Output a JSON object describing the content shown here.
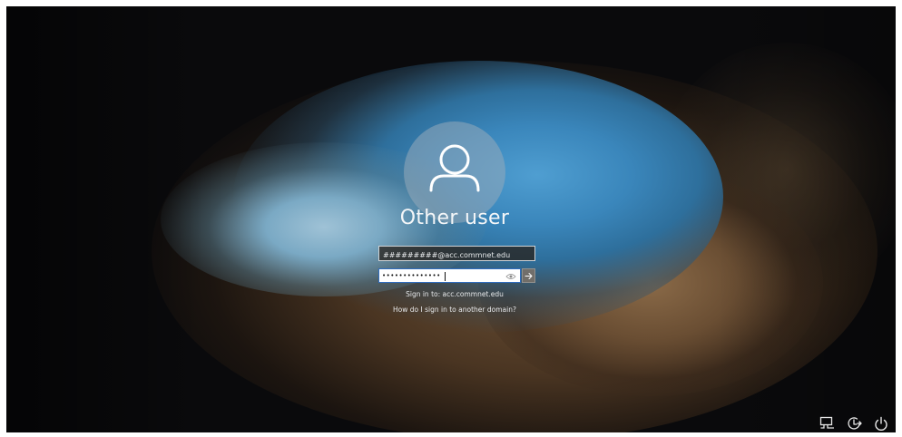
{
  "user": {
    "name": "Other user",
    "avatar_icon": "person-icon"
  },
  "login": {
    "username_value": "#########@acc.commnet.edu",
    "password_value": "••••••••••••••",
    "reveal_icon": "eye-icon",
    "submit_icon": "arrow-right-icon",
    "sign_in_to": "Sign in to: acc.commnet.edu",
    "help_link": "How do I sign in to another domain?"
  },
  "tray": {
    "icons": [
      "network-icon",
      "accessibility-icon",
      "power-icon"
    ]
  },
  "colors": {
    "field_border_focus": "#2f6cc0",
    "avatar_circle": "#96aab9"
  }
}
